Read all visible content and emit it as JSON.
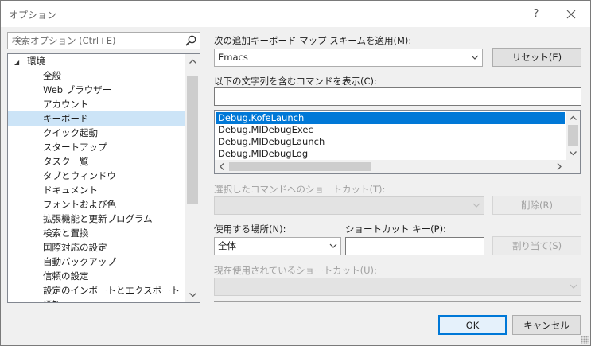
{
  "window": {
    "title": "オプション",
    "help_label": "?",
    "close_label": "✕"
  },
  "search": {
    "placeholder": "検索オプション (Ctrl+E)"
  },
  "tree": {
    "root": "環境",
    "items": [
      "全般",
      "Web ブラウザー",
      "アカウント",
      "キーボード",
      "クイック起動",
      "スタートアップ",
      "タスク一覧",
      "タブとウィンドウ",
      "ドキュメント",
      "フォントおよび色",
      "拡張機能と更新プログラム",
      "検索と置換",
      "国際対応の設定",
      "自動バックアップ",
      "信頼の設定",
      "設定のインポートとエクスポート",
      "通知"
    ],
    "selected_index": 3
  },
  "keyboard": {
    "mapping_label": "次の追加キーボード マップ スキームを適用(M):",
    "mapping_value": "Emacs",
    "reset_label": "リセット(E)",
    "filter_label": "以下の文字列を含むコマンドを表示(C):",
    "filter_value": "",
    "commands": [
      "Debug.KofeLaunch",
      "Debug.MIDebugExec",
      "Debug.MIDebugLaunch",
      "Debug.MIDebugLog"
    ],
    "selected_command_index": 0,
    "shortcuts_label": "選択したコマンドへのショートカット(T):",
    "shortcuts_value": "",
    "remove_label": "削除(R)",
    "use_in_label": "使用する場所(N):",
    "use_in_value": "全体",
    "shortcut_key_label": "ショートカット キー(P):",
    "shortcut_key_value": "",
    "assign_label": "割り当て(S)",
    "currently_used_label": "現在使用されているショートカット(U):",
    "currently_used_value": ""
  },
  "footer": {
    "ok_label": "OK",
    "cancel_label": "キャンセル"
  }
}
